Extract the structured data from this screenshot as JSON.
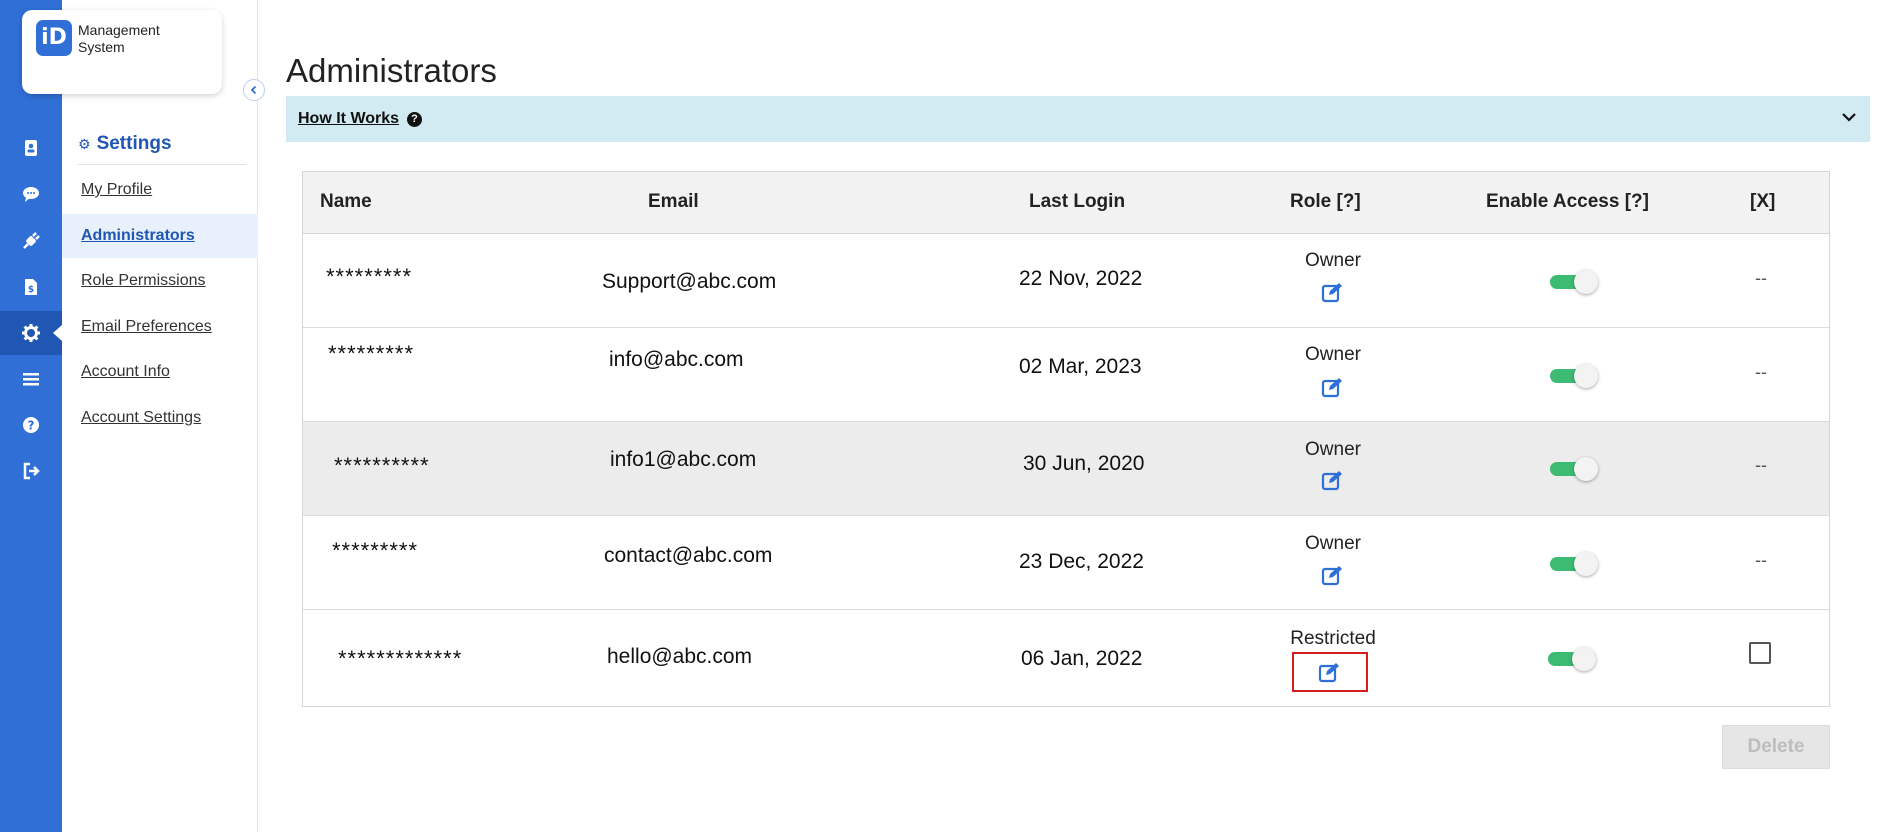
{
  "app": {
    "logo_mark": "iD",
    "logo_line1": "Management",
    "logo_line2": "System"
  },
  "rail": {
    "items": [
      {
        "icon": "contacts-icon"
      },
      {
        "icon": "chat-icon"
      },
      {
        "icon": "plug-icon"
      },
      {
        "icon": "billing-icon"
      },
      {
        "icon": "gear-icon",
        "active": true
      },
      {
        "icon": "list-icon"
      },
      {
        "icon": "help-icon"
      },
      {
        "icon": "logout-icon"
      }
    ]
  },
  "settings": {
    "heading": "Settings",
    "menu": [
      {
        "label": "My Profile"
      },
      {
        "label": "Administrators",
        "active": true
      },
      {
        "label": "Role Permissions"
      },
      {
        "label": "Email Preferences"
      },
      {
        "label": "Account Info"
      },
      {
        "label": "Account Settings"
      }
    ]
  },
  "page": {
    "title": "Administrators"
  },
  "how_it_works": {
    "label": "How It Works",
    "help_glyph": "?"
  },
  "table": {
    "headers": {
      "name": "Name",
      "email": "Email",
      "last_login": "Last Login",
      "role": "Role [?]",
      "enable_access": "Enable Access [?]",
      "delete": "[X]"
    },
    "rows": [
      {
        "name": "*********",
        "email": "Support@abc.com",
        "last_login": "22 Nov, 2022",
        "role": "Owner",
        "enabled": true,
        "delete": "--"
      },
      {
        "name": "*********",
        "email": "info@abc.com",
        "last_login": "02 Mar, 2023",
        "role": "Owner",
        "enabled": true,
        "delete": "--"
      },
      {
        "name": "**********",
        "email": "info1@abc.com",
        "last_login": "30 Jun, 2020",
        "role": "Owner",
        "enabled": true,
        "delete": "--"
      },
      {
        "name": "*********",
        "email": "contact@abc.com",
        "last_login": "23 Dec, 2022",
        "role": "Owner",
        "enabled": true,
        "delete": "--"
      },
      {
        "name": "*************",
        "email": "hello@abc.com",
        "last_login": "06 Jan, 2022",
        "role": "Restricted",
        "enabled": true,
        "delete": "checkbox"
      }
    ]
  },
  "actions": {
    "delete_label": "Delete"
  },
  "colors": {
    "primary": "#2f6fd6",
    "toggle_on": "#3dbb73",
    "highlight": "#d51f1f",
    "banner": "#d2eaf1"
  }
}
